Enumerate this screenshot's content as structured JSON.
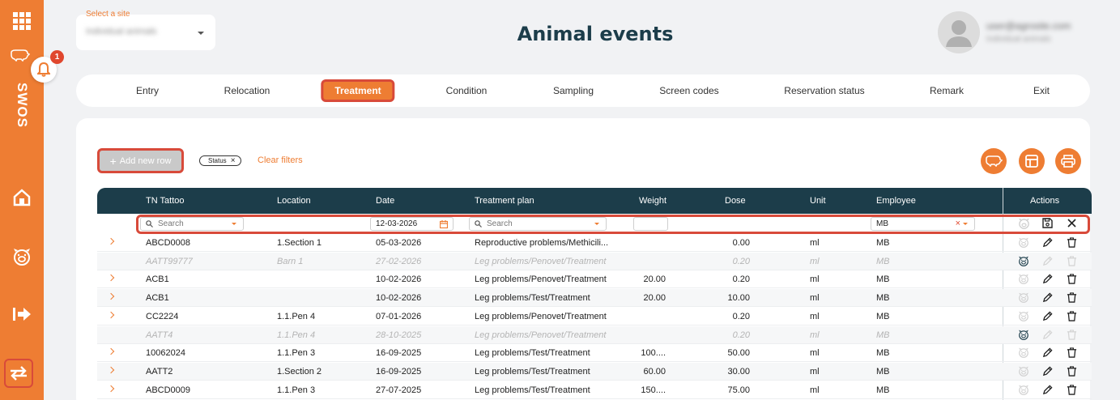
{
  "sidebar": {
    "brand": "SWOS",
    "notification_count": "1",
    "icons": [
      "grid-icon",
      "pig-icon",
      "home-icon",
      "pig-face-icon",
      "logout-icon",
      "swap-icon"
    ]
  },
  "site_select": {
    "label": "Select a site",
    "value": "Individual animals"
  },
  "page_title": "Animal events",
  "user": {
    "email": "user@agrosite.com",
    "subtitle": "Individual animals"
  },
  "tabs": [
    {
      "label": "Entry",
      "active": false
    },
    {
      "label": "Relocation",
      "active": false
    },
    {
      "label": "Treatment",
      "active": true
    },
    {
      "label": "Condition",
      "active": false
    },
    {
      "label": "Sampling",
      "active": false
    },
    {
      "label": "Screen codes",
      "active": false
    },
    {
      "label": "Reservation status",
      "active": false
    },
    {
      "label": "Remark",
      "active": false
    },
    {
      "label": "Exit",
      "active": false
    }
  ],
  "toolbar": {
    "add_row": "Add new row",
    "status_chip": "Status",
    "clear_filters": "Clear filters"
  },
  "table": {
    "columns": [
      "TN Tattoo",
      "Location",
      "Date",
      "Treatment plan",
      "Weight",
      "Dose",
      "Unit",
      "Employee",
      "Actions"
    ],
    "filters": {
      "tattoo_placeholder": "Search",
      "date": "12-03-2026",
      "plan_placeholder": "Search",
      "weight": "",
      "employee": "MB"
    },
    "rows": [
      {
        "tattoo": "ABCD0008",
        "location": "1.Section 1",
        "date": "05-03-2026",
        "plan": "Reproductive problems/Methicili...",
        "weight": "",
        "dose": "0.00",
        "unit": "ml",
        "employee": "MB",
        "inactive": false
      },
      {
        "tattoo": "AATT99777",
        "location": "Barn 1",
        "date": "27-02-2026",
        "plan": "Leg problems/Penovet/Treatment",
        "weight": "",
        "dose": "0.20",
        "unit": "ml",
        "employee": "MB",
        "inactive": true
      },
      {
        "tattoo": "ACB1",
        "location": "",
        "date": "10-02-2026",
        "plan": "Leg problems/Penovet/Treatment",
        "weight": "20.00",
        "dose": "0.20",
        "unit": "ml",
        "employee": "MB",
        "inactive": false
      },
      {
        "tattoo": "ACB1",
        "location": "",
        "date": "10-02-2026",
        "plan": "Leg problems/Test/Treatment",
        "weight": "20.00",
        "dose": "10.00",
        "unit": "ml",
        "employee": "MB",
        "inactive": false
      },
      {
        "tattoo": "CC2224",
        "location": "1.1.Pen 4",
        "date": "07-01-2026",
        "plan": "Leg problems/Penovet/Treatment",
        "weight": "",
        "dose": "0.20",
        "unit": "ml",
        "employee": "MB",
        "inactive": false
      },
      {
        "tattoo": "AATT4",
        "location": "1.1.Pen 4",
        "date": "28-10-2025",
        "plan": "Leg problems/Penovet/Treatment",
        "weight": "",
        "dose": "0.20",
        "unit": "ml",
        "employee": "MB",
        "inactive": true
      },
      {
        "tattoo": "10062024",
        "location": "1.1.Pen 3",
        "date": "16-09-2025",
        "plan": "Leg problems/Test/Treatment",
        "weight": "100....",
        "dose": "50.00",
        "unit": "ml",
        "employee": "MB",
        "inactive": false
      },
      {
        "tattoo": "AATT2",
        "location": "1.Section 2",
        "date": "16-09-2025",
        "plan": "Leg problems/Test/Treatment",
        "weight": "60.00",
        "dose": "30.00",
        "unit": "ml",
        "employee": "MB",
        "inactive": false
      },
      {
        "tattoo": "ABCD0009",
        "location": "1.1.Pen 3",
        "date": "27-07-2025",
        "plan": "Leg problems/Test/Treatment",
        "weight": "150....",
        "dose": "75.00",
        "unit": "ml",
        "employee": "MB",
        "inactive": false
      }
    ]
  },
  "colors": {
    "accent": "#ee7d33",
    "header": "#1c3d4a",
    "highlight": "#d84a3a"
  }
}
